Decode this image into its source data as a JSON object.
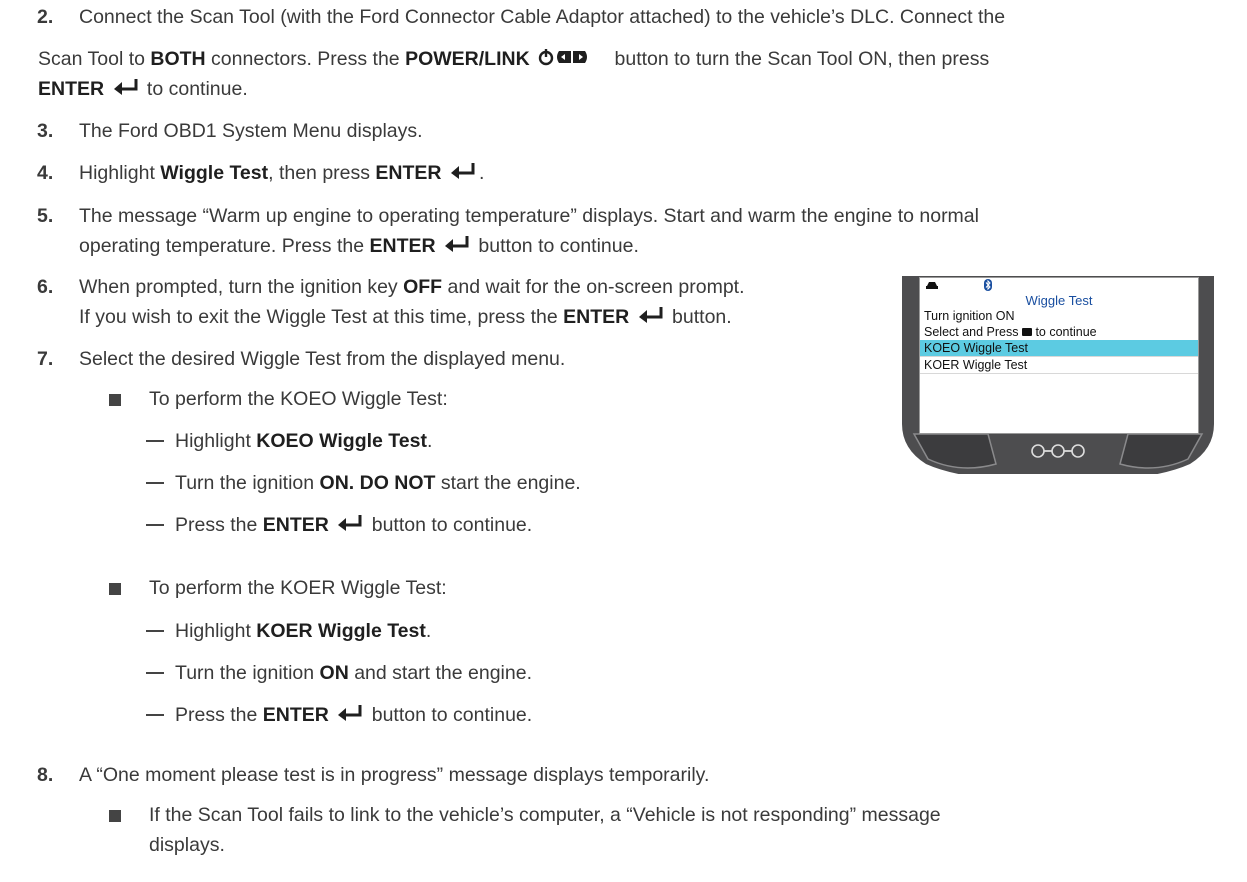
{
  "steps": {
    "s2": {
      "num": "2.",
      "line1": "Connect the Scan Tool (with the Ford Connector Cable Adaptor attached) to the vehicle’s DLC. Connect the",
      "line2_a": "Scan Tool to ",
      "line2_b": "BOTH",
      "line2_c": " connectors. Press the ",
      "line2_d": "POWER/LINK",
      "line2_e": " button to turn the Scan Tool ON, then press",
      "line3_a": "ENTER",
      "line3_b": " to continue."
    },
    "s3": {
      "num": "3.",
      "text": "The Ford OBD1 System Menu displays."
    },
    "s4": {
      "num": "4.",
      "a": "Highlight ",
      "b": "Wiggle Test",
      "c": ", then press ",
      "d": "ENTER",
      "e": "."
    },
    "s5": {
      "num": "5.",
      "line1": "The message “Warm up engine to operating temperature” displays. Start and warm the engine to normal",
      "line2_a": "operating temperature. Press the ",
      "line2_b": "ENTER",
      "line2_c": " button to continue."
    },
    "s6": {
      "num": "6.",
      "line1_a": "When prompted, turn the ignition key ",
      "line1_b": "OFF",
      "line1_c": " and wait for the on-screen prompt.",
      "line2_a": "If you wish to exit the Wiggle Test at this time, press the ",
      "line2_b": "ENTER",
      "line2_c": " button."
    },
    "s7": {
      "num": "7.",
      "text": "Select the desired Wiggle Test from the displayed menu.",
      "koeo": {
        "bullet": "To perform the KOEO Wiggle Test:",
        "d1_a": "Highlight ",
        "d1_b": "KOEO Wiggle Test",
        "d1_c": ".",
        "d2_a": "Turn the ignition ",
        "d2_b": "ON. DO NOT",
        "d2_c": " start the engine.",
        "d3_a": "Press the ",
        "d3_b": "ENTER",
        "d3_c": " button to continue."
      },
      "koer": {
        "bullet": "To perform the KOER Wiggle Test:",
        "d1_a": "Highlight ",
        "d1_b": "KOER Wiggle Test",
        "d1_c": ".",
        "d2_a": "Turn the ignition ",
        "d2_b": "ON",
        "d2_c": " and start the engine.",
        "d3_a": "Press the ",
        "d3_b": "ENTER",
        "d3_c": " button to continue."
      }
    },
    "s8": {
      "num": "8.",
      "text": "A “One moment please test is in progress” message displays temporarily.",
      "bullet_line1": "If the Scan Tool fails to link to the vehicle’s computer, a “Vehicle is not responding” message",
      "bullet_line2": "displays."
    }
  },
  "device": {
    "title": "Wiggle Test",
    "line1": "Turn ignition ON",
    "line2_a": "Select and Press ",
    "line2_b": " to continue",
    "items": [
      "KOEO Wiggle Test",
      "KOER Wiggle Test"
    ],
    "highlighted_index": 0,
    "highlight_color": "#5ccbe2",
    "title_color": "#1a4fa0"
  }
}
